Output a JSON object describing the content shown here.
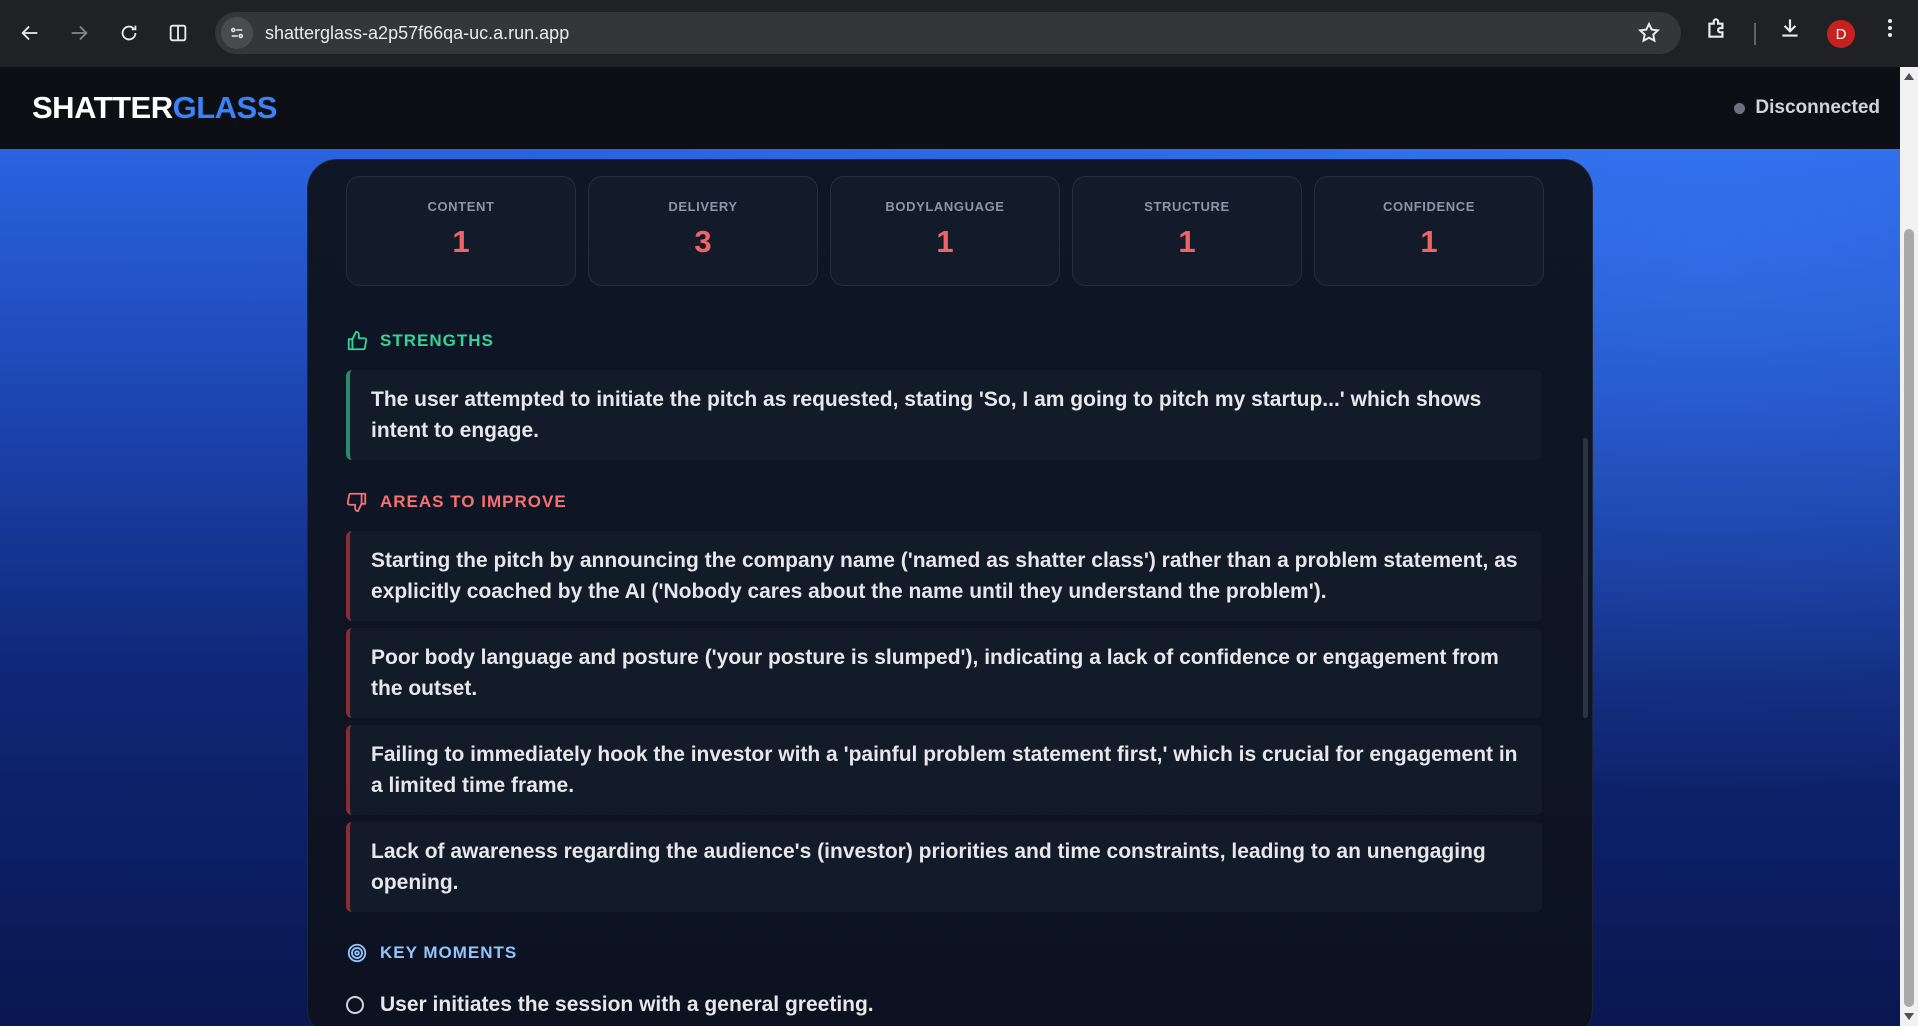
{
  "browser": {
    "url": "shatterglass-a2p57f66qa-uc.a.run.app",
    "profile_initial": "D"
  },
  "header": {
    "logo_part1": "SHATTER",
    "logo_part2": "GLASS",
    "status": "Disconnected"
  },
  "scores": [
    {
      "label": "CONTENT",
      "value": "1"
    },
    {
      "label": "DELIVERY",
      "value": "3"
    },
    {
      "label": "BODYLANGUAGE",
      "value": "1"
    },
    {
      "label": "STRUCTURE",
      "value": "1"
    },
    {
      "label": "CONFIDENCE",
      "value": "1"
    }
  ],
  "strengths": {
    "title": "STRENGTHS",
    "items": [
      "The user attempted to initiate the pitch as requested, stating 'So, I am going to pitch my startup...' which shows intent to engage."
    ]
  },
  "improve": {
    "title": "AREAS TO IMPROVE",
    "items": [
      "Starting the pitch by announcing the company name ('named as shatter class') rather than a problem statement, as explicitly coached by the AI ('Nobody cares about the name until they understand the problem').",
      "Poor body language and posture ('your posture is slumped'), indicating a lack of confidence or engagement from the outset.",
      "Failing to immediately hook the investor with a 'painful problem statement first,' which is crucial for engagement in a limited time frame.",
      "Lack of awareness regarding the audience's (investor) priorities and time constraints, leading to an unengaging opening."
    ]
  },
  "key_moments": {
    "title": "KEY MOMENTS",
    "items": [
      "User initiates the session with a general greeting."
    ]
  },
  "colors": {
    "accent": "#3b82f6",
    "score": "#f26464",
    "strength": "#34d399",
    "improve": "#f87171",
    "status_dot": "#6b7280"
  }
}
